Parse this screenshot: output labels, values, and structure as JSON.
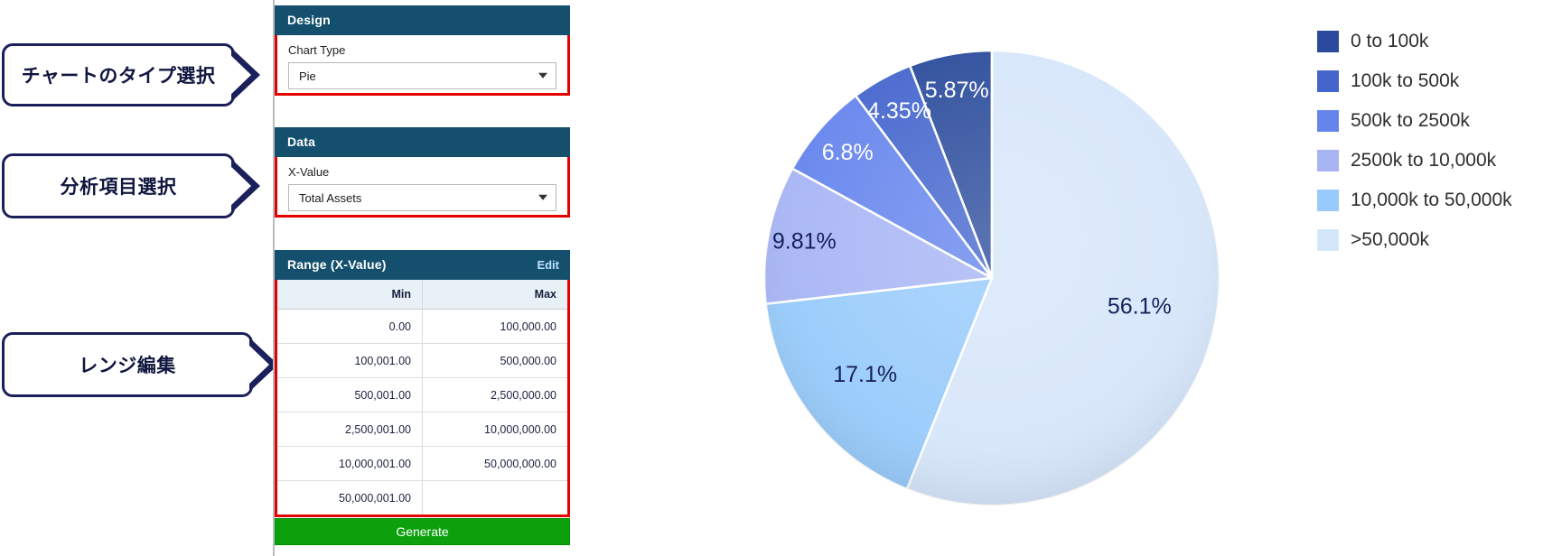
{
  "annotations": [
    {
      "id": "chart-type",
      "label": "チャートのタイプ選択"
    },
    {
      "id": "x-value",
      "label": "分析項目選択"
    },
    {
      "id": "range",
      "label": "レンジ編集"
    }
  ],
  "panel": {
    "design": {
      "header": "Design",
      "field_label": "Chart Type",
      "selected": "Pie"
    },
    "data": {
      "header": "Data",
      "field_label": "X-Value",
      "selected": "Total Assets"
    },
    "range": {
      "header": "Range (X-Value)",
      "edit_label": "Edit",
      "columns": [
        "Min",
        "Max"
      ],
      "rows": [
        [
          "0.00",
          "100,000.00"
        ],
        [
          "100,001.00",
          "500,000.00"
        ],
        [
          "500,001.00",
          "2,500,000.00"
        ],
        [
          "2,500,001.00",
          "10,000,000.00"
        ],
        [
          "10,000,001.00",
          "50,000,000.00"
        ],
        [
          "50,000,001.00",
          ""
        ]
      ]
    },
    "generate_label": "Generate"
  },
  "chart_data": {
    "type": "pie",
    "title": "",
    "categories": [
      "0 to 100k",
      "100k to 500k",
      "500k to 2500k",
      "2500k to 10,000k",
      "10,000k to 50,000k",
      ">50,000k"
    ],
    "values": [
      5.87,
      4.35,
      6.8,
      9.81,
      17.1,
      56.1
    ],
    "value_labels": [
      "5.87%",
      "4.35%",
      "6.8%",
      "9.81%",
      "17.1%",
      "56.1%"
    ],
    "unit": "%",
    "colors": [
      "#2a4b9b",
      "#4465cd",
      "#6585ed",
      "#a7b5f5",
      "#98cbfb",
      "#d6e6fa"
    ],
    "legend_position": "right",
    "start_angle_deg": -90,
    "direction": "counterclockwise"
  }
}
